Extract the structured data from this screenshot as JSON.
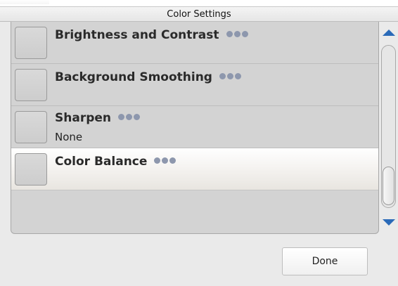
{
  "window": {
    "title": "Color Settings"
  },
  "list": {
    "items": [
      {
        "label": "Brightness and Contrast",
        "value": "",
        "selected": false,
        "more_icon": "ellipsis-dots-icon"
      },
      {
        "label": "Background Smoothing",
        "value": "",
        "selected": false,
        "more_icon": "ellipsis-dots-icon"
      },
      {
        "label": "Sharpen",
        "value": "None",
        "selected": false,
        "more_icon": "ellipsis-dots-icon"
      },
      {
        "label": "Color Balance",
        "value": "",
        "selected": true,
        "more_icon": "ellipsis-dots-icon"
      }
    ]
  },
  "scrollbar": {
    "up_icon": "arrow-up-icon",
    "down_icon": "arrow-down-icon"
  },
  "footer": {
    "done_label": "Done"
  },
  "colors": {
    "accent_arrow": "#2a6ab8",
    "dots": "#8d97ad",
    "list_background": "#d3d3d3",
    "selected_background": "#f3f1ee"
  }
}
